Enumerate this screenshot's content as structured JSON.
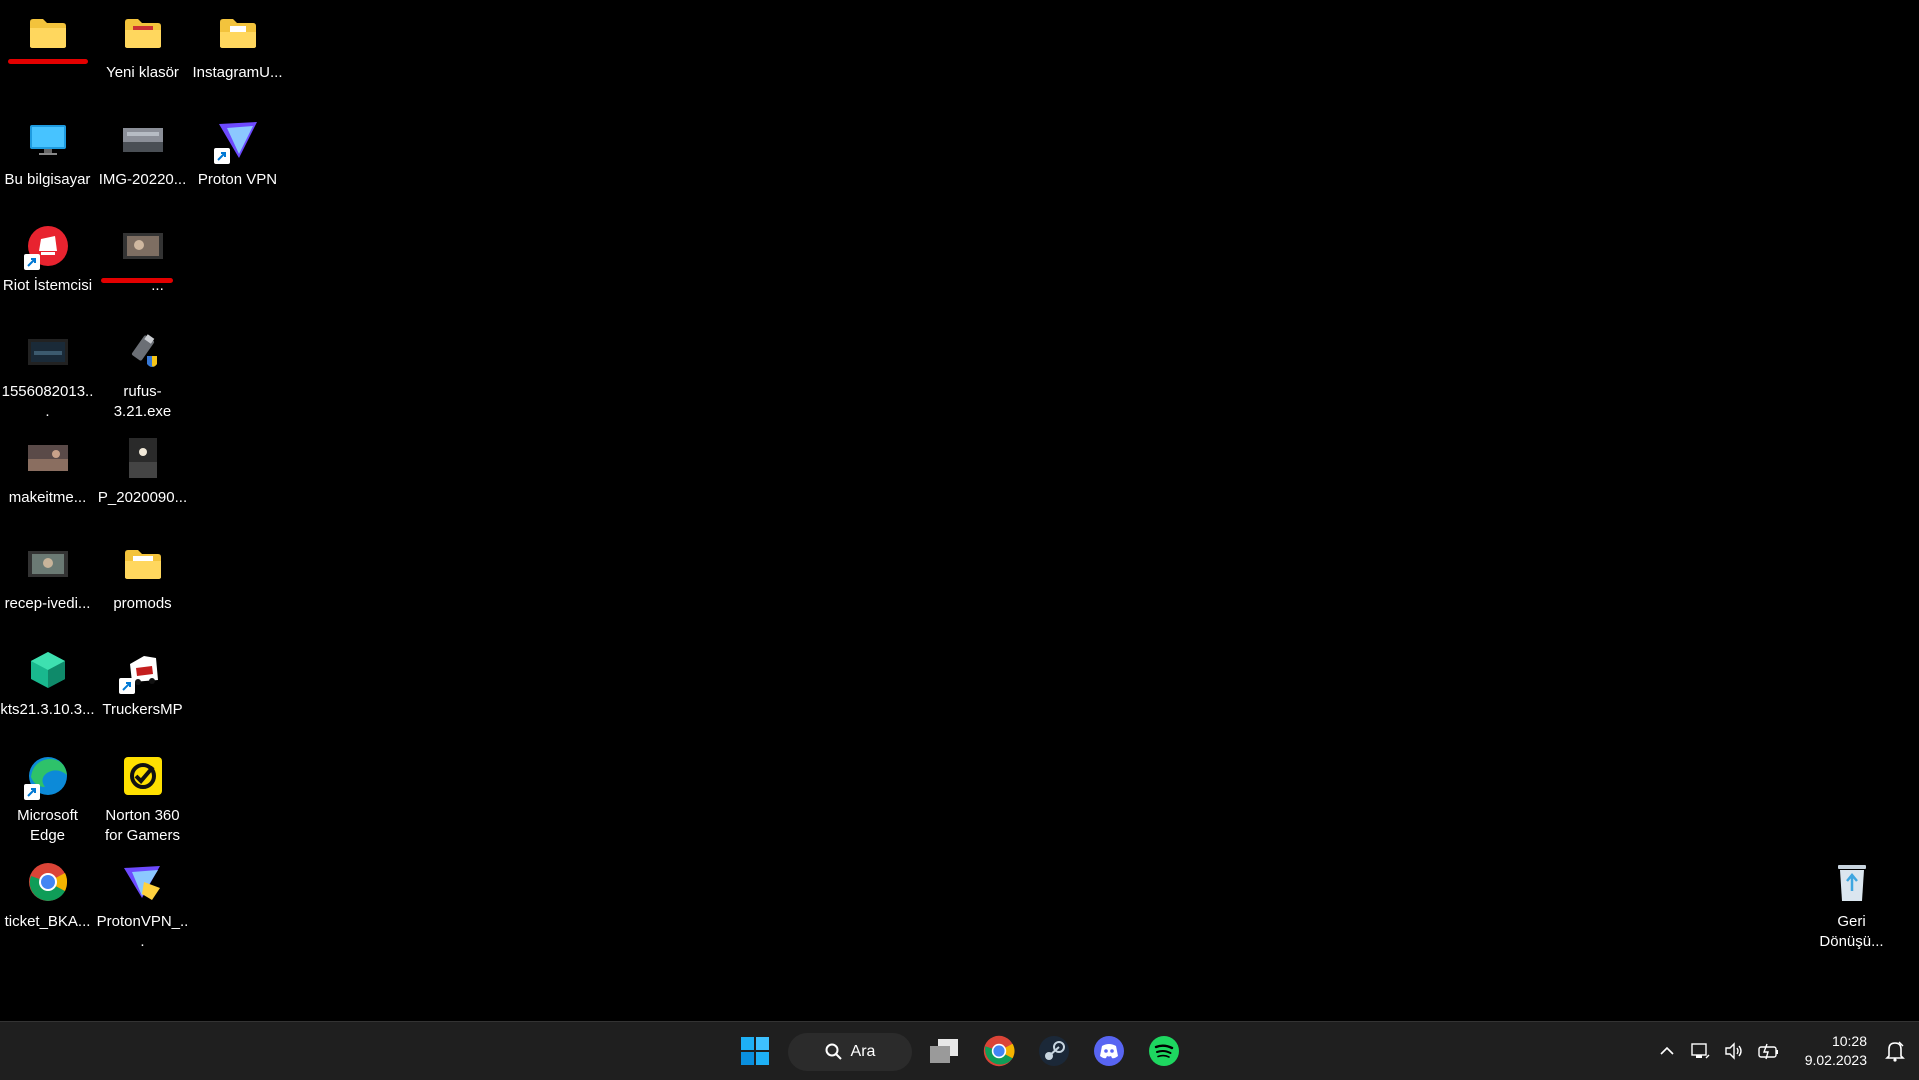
{
  "desktop": {
    "icons": [
      {
        "label": "",
        "icon": "folder-icon",
        "redacted": true
      },
      {
        "label": "Yeni klasör",
        "icon": "folder-icon"
      },
      {
        "label": "InstagramU...",
        "icon": "folder-icon"
      },
      {
        "label": "Bu bilgisayar",
        "icon": "monitor-icon"
      },
      {
        "label": "IMG-20220...",
        "icon": "image-thumbnail-icon"
      },
      {
        "label": "Proton VPN",
        "icon": "proton-vpn-icon"
      },
      {
        "label": "Riot İstemcisi",
        "icon": "riot-client-icon"
      },
      {
        "label": "...",
        "icon": "video-thumbnail-icon",
        "redacted": true
      },
      {
        "label": "1556082013...",
        "icon": "video-thumbnail-icon"
      },
      {
        "label": "rufus-3.21.exe",
        "icon": "usb-drive-icon"
      },
      {
        "label": "makeitme...",
        "icon": "image-thumbnail-icon"
      },
      {
        "label": "P_2020090...",
        "icon": "image-thumbnail-icon"
      },
      {
        "label": "recep-ivedi...",
        "icon": "video-thumbnail-icon"
      },
      {
        "label": "promods",
        "icon": "folder-icon"
      },
      {
        "label": "kts21.3.10.3...",
        "icon": "installer-package-icon"
      },
      {
        "label": "TruckersMP",
        "icon": "truckersmp-icon"
      },
      {
        "label": "Microsoft Edge",
        "icon": "edge-icon"
      },
      {
        "label": "Norton 360 for Gamers",
        "icon": "norton-icon"
      },
      {
        "label": "ticket_BKA...",
        "icon": "chrome-icon"
      },
      {
        "label": "ProtonVPN_...",
        "icon": "protonvpn-installer-icon"
      },
      {
        "label": "Geri Dönüşü...",
        "icon": "recycle-bin-icon"
      }
    ]
  },
  "taskbar": {
    "search_label": "Ara",
    "apps": [
      "start-icon",
      "search-icon",
      "task-view-icon",
      "chrome-icon",
      "steam-icon",
      "discord-icon",
      "spotify-icon"
    ],
    "clock_time": "10:28",
    "clock_date": "9.02.2023"
  },
  "colors": {
    "desktop_bg": "#000000",
    "taskbar_bg": "#1f1f1f",
    "windows_blue": "#0078d4",
    "spotify_green": "#1ed760",
    "discord_blurple": "#5865f2"
  }
}
